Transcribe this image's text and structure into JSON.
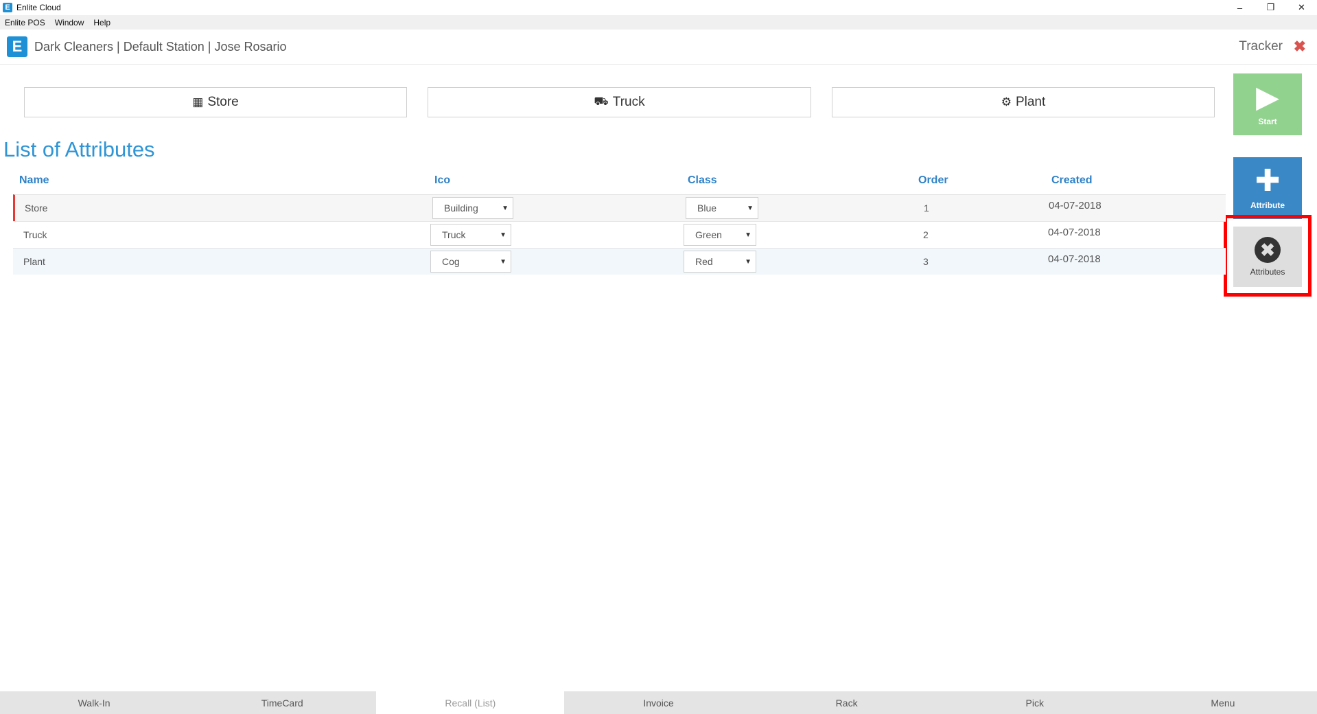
{
  "window": {
    "app_icon": "E",
    "title": "Enlite Cloud",
    "controls": {
      "minimize": "–",
      "restore": "❐",
      "close": "✕"
    }
  },
  "menubar": [
    "Enlite POS",
    "Window",
    "Help"
  ],
  "header": {
    "logo": "E",
    "context": "Dark Cleaners | Default Station | Jose Rosario",
    "right_label": "Tracker",
    "close_glyph": "✖"
  },
  "filters": [
    {
      "label": "Store",
      "icon": "building-icon",
      "glyph": "▦"
    },
    {
      "label": "Truck",
      "icon": "truck-icon",
      "glyph": "⛟"
    },
    {
      "label": "Plant",
      "icon": "cog-icon",
      "glyph": "⚙"
    }
  ],
  "actions": {
    "start": {
      "label": "Start",
      "icon": "play-icon",
      "glyph": "▶",
      "color": "#92d28f"
    },
    "attribute": {
      "label": "Attribute",
      "icon": "plus-icon",
      "glyph": "✚",
      "color": "#3b88c6"
    },
    "attributes": {
      "label": "Attributes",
      "icon": "close-circle-icon",
      "glyph": "✖",
      "color": "#dedede"
    }
  },
  "section_title": "List of Attributes",
  "table": {
    "headers": {
      "name": "Name",
      "ico": "Ico",
      "class": "Class",
      "order": "Order",
      "created": "Created"
    },
    "rows": [
      {
        "name": "Store",
        "ico": "Building",
        "class": "Blue",
        "order": "1",
        "created": "04-07-2018"
      },
      {
        "name": "Truck",
        "ico": "Truck",
        "class": "Green",
        "order": "2",
        "created": "04-07-2018"
      },
      {
        "name": "Plant",
        "ico": "Cog",
        "class": "Red",
        "order": "3",
        "created": "04-07-2018"
      }
    ]
  },
  "bottom_tabs": [
    "Walk-In",
    "TimeCard",
    "Recall (List)",
    "Invoice",
    "Rack",
    "Pick",
    "Menu"
  ],
  "selected_bottom_tab": "Recall (List)"
}
